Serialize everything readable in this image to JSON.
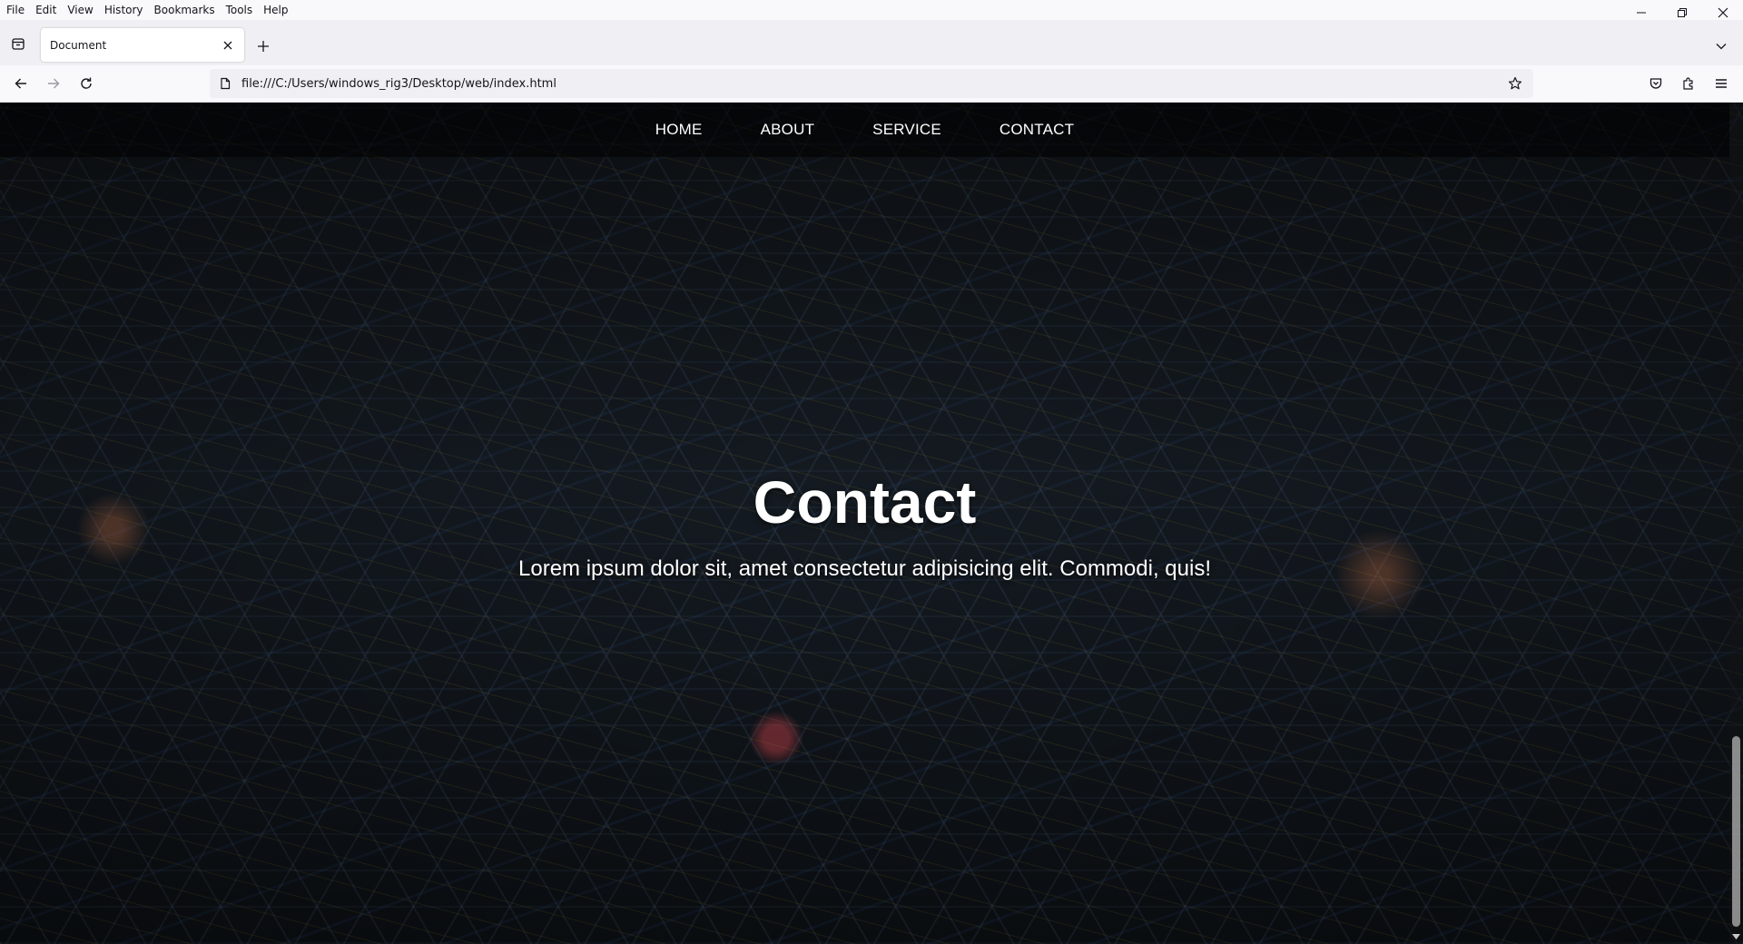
{
  "menubar": {
    "items": [
      "File",
      "Edit",
      "View",
      "History",
      "Bookmarks",
      "Tools",
      "Help"
    ]
  },
  "tab": {
    "title": "Document"
  },
  "urlbar": {
    "url": "file:///C:/Users/windows_rig3/Desktop/web/index.html"
  },
  "site": {
    "nav": [
      "HOME",
      "ABOUT",
      "SERVICE",
      "CONTACT"
    ],
    "hero_title": "Contact",
    "hero_subtitle": "Lorem ipsum dolor sit, amet consectetur adipisicing elit. Commodi, quis!"
  },
  "icons": {
    "tab_list": "tab-list-icon",
    "close_tab": "close-icon",
    "new_tab": "plus-icon",
    "back": "arrow-left-icon",
    "forward": "arrow-right-icon",
    "reload": "reload-icon",
    "page": "page-icon",
    "bookmark": "star-icon",
    "pocket": "pocket-icon",
    "extensions": "puzzle-icon",
    "menu": "hamburger-icon"
  },
  "colors": {
    "chrome_bg": "#f9f9fb",
    "tabbar_bg": "#f0f0f4",
    "text": "#15141a",
    "hero_text": "#ffffff"
  }
}
